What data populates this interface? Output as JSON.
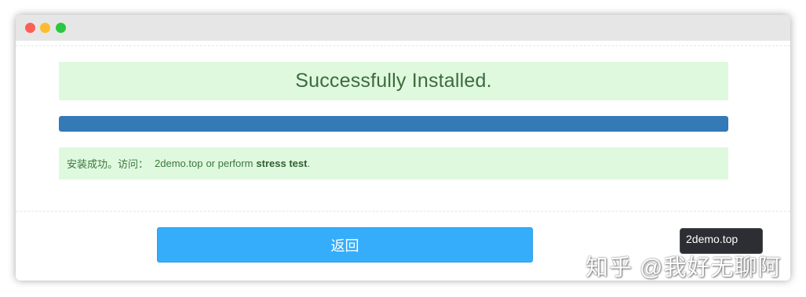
{
  "window": {
    "controls": {
      "close_icon": "close-dot-icon",
      "minimize_icon": "minimize-dot-icon",
      "maximize_icon": "maximize-dot-icon"
    }
  },
  "main": {
    "success_title": "Successfully Installed.",
    "progress_percent": 100,
    "info": {
      "prefix": "安装成功。访问：",
      "link": "2demo.top",
      "middle": "or perform",
      "strong": "stress test",
      "suffix": "."
    }
  },
  "footer": {
    "back_label": "返回"
  },
  "tooltip": {
    "text": "2demo.top"
  },
  "watermark": {
    "text": "知乎 @我好无聊阿"
  },
  "colors": {
    "success_bg": "#dff9df",
    "progress_fill": "#337ab7",
    "button_bg": "#35adfb"
  }
}
